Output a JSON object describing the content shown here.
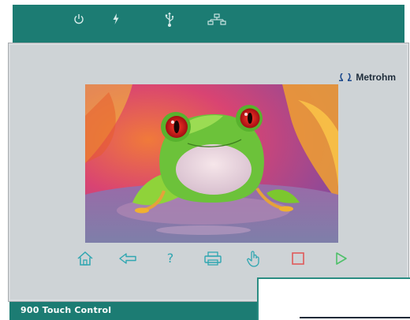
{
  "status_bar": {
    "icons": [
      "power-icon",
      "lightning-icon",
      "usb-icon",
      "network-icon"
    ]
  },
  "brand": {
    "logo_text": "Metrohm"
  },
  "screen": {
    "image": "red-eyed-tree-frog-photo"
  },
  "toolbar": {
    "buttons": [
      "home-icon",
      "back-arrow-icon",
      "help-icon",
      "print-icon",
      "hand-icon",
      "stop-icon",
      "start-icon"
    ],
    "help_glyph": "?"
  },
  "device": {
    "label": "900  Touch Control"
  },
  "colors": {
    "frame_teal": "#1c7c73",
    "icon_teal": "#2fa6b1",
    "stop_red": "#e05a5a",
    "start_green": "#4fc06a"
  }
}
